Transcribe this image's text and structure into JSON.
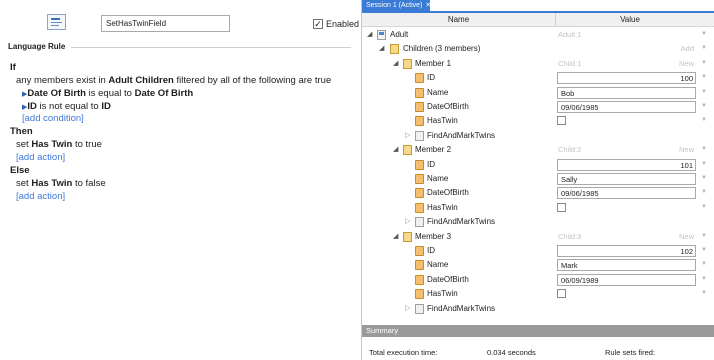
{
  "rule": {
    "name": "SetHasTwinField",
    "enabled_check": "✓",
    "enabled_label": "Enabled",
    "section_title": "Language Rule"
  },
  "rule_text": {
    "if": "If",
    "cond_prefix": "any members exist in",
    "cond_collection": "Adult Children",
    "cond_mid": "filtered by all of the following are true",
    "c1_field": "Date Of Birth",
    "c1_op": "is equal to",
    "c1_value": "Date Of Birth",
    "c2_field": "ID",
    "c2_op": "is not equal to",
    "c2_value": "ID",
    "add_condition": "[add condition]",
    "then": "Then",
    "then_set": "set",
    "then_field": "Has Twin",
    "then_to": "to true",
    "add_action_1": "[add action]",
    "else": "Else",
    "else_set": "set",
    "else_field": "Has Twin",
    "else_to": "to false",
    "add_action_2": "[add action]"
  },
  "session": {
    "tab_label": "Session 1 (Active)",
    "tab_close": "✕",
    "col_name": "Name",
    "col_value": "Value"
  },
  "tree": {
    "adult": "Adult",
    "adult_hint": "Adult:1",
    "children": "Children (3 members)",
    "add": "Add",
    "members": [
      {
        "label": "Member 1",
        "hint": "Child:1",
        "action": "New",
        "id_label": "ID",
        "id": "100",
        "name_label": "Name",
        "name": "Bob",
        "dob_label": "DateOfBirth",
        "dob": "09/06/1985",
        "twin_label": "HasTwin",
        "method_label": "FindAndMarkTwins"
      },
      {
        "label": "Member 2",
        "hint": "Child:2",
        "action": "New",
        "id_label": "ID",
        "id": "101",
        "name_label": "Name",
        "name": "Sally",
        "dob_label": "DateOfBirth",
        "dob": "09/06/1985",
        "twin_label": "HasTwin",
        "method_label": "FindAndMarkTwins"
      },
      {
        "label": "Member 3",
        "hint": "Child:3",
        "action": "New",
        "id_label": "ID",
        "id": "102",
        "name_label": "Name",
        "name": "Mark",
        "dob_label": "DateOfBirth",
        "dob": "06/09/1989",
        "twin_label": "HasTwin",
        "method_label": "FindAndMarkTwins"
      }
    ]
  },
  "summary": {
    "title": "Summary",
    "exec_label": "Total execution time:",
    "exec_value": "0.034 seconds",
    "fired_label": "Rule sets fired:"
  }
}
